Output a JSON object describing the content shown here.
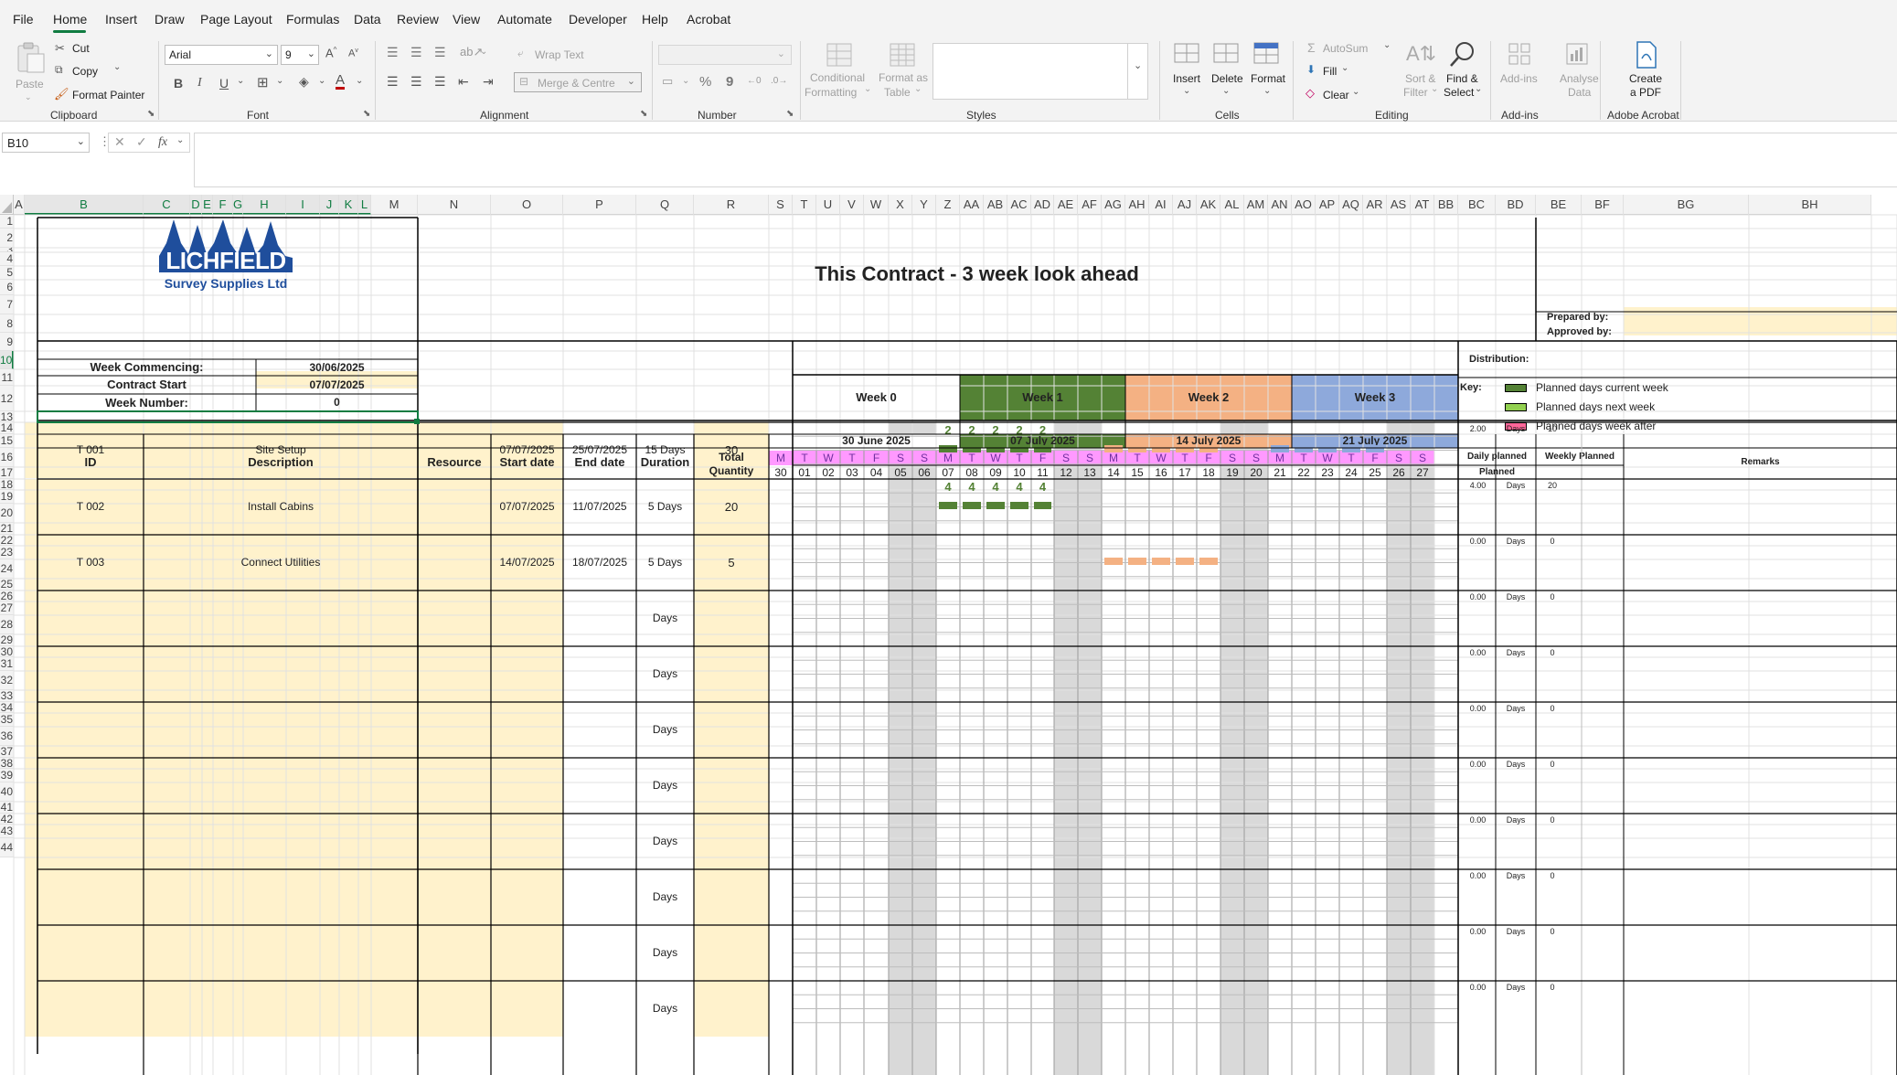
{
  "tabs": [
    "File",
    "Home",
    "Insert",
    "Draw",
    "Page Layout",
    "Formulas",
    "Data",
    "Review",
    "View",
    "Automate",
    "Developer",
    "Help",
    "Acrobat"
  ],
  "ribbon": {
    "clipboard": {
      "paste": "Paste",
      "cut": "Cut",
      "copy": "Copy",
      "format_painter": "Format Painter",
      "label": "Clipboard"
    },
    "font": {
      "family": "Arial",
      "size": "9",
      "bold": "B",
      "italic": "I",
      "underline": "U",
      "label": "Font"
    },
    "alignment": {
      "wrap": "Wrap Text",
      "merge": "Merge & Centre",
      "label": "Alignment"
    },
    "number": {
      "percent": "%",
      "comma": "9",
      "label": "Number"
    },
    "styles": {
      "conditional": "Conditional",
      "conditional2": "Formatting",
      "format_table": "Format as",
      "format_table2": "Table",
      "label": "Styles"
    },
    "cells": {
      "insert": "Insert",
      "delete": "Delete",
      "format": "Format",
      "label": "Cells"
    },
    "editing": {
      "autosum": "AutoSum",
      "fill": "Fill",
      "clear": "Clear",
      "sort": "Sort &",
      "sort2": "Filter",
      "find": "Find &",
      "find2": "Select",
      "label": "Editing"
    },
    "addins": {
      "addins": "Add-ins",
      "analyse": "Analyse",
      "analyse2": "Data",
      "label": "Add-ins"
    },
    "acrobat": {
      "create": "Create",
      "create2": "a PDF",
      "label": "Adobe Acrobat"
    }
  },
  "formula_bar": {
    "name_box": "B10",
    "fx": "fx",
    "value": ""
  },
  "columns": [
    "A",
    "B",
    "C",
    "D",
    "E",
    "F",
    "G",
    "H",
    "I",
    "J",
    "K",
    "L",
    "M",
    "N",
    "O",
    "P",
    "Q",
    "R",
    "S",
    "T",
    "U",
    "V",
    "W",
    "X",
    "Y",
    "Z",
    "AA",
    "AB",
    "AC",
    "AD",
    "AE",
    "AF",
    "AG",
    "AH",
    "AI",
    "AJ",
    "AK",
    "AL",
    "AM",
    "AN",
    "AO",
    "AP",
    "AQ",
    "AR",
    "AS",
    "AT",
    "BB",
    "BC",
    "BD",
    "BE",
    "BF",
    "BG",
    "BH"
  ],
  "rows": [
    "1",
    "2",
    "3",
    "4",
    "5",
    "6",
    "7",
    "8",
    "9",
    "10",
    "11",
    "12",
    "13",
    "14",
    "15",
    "16",
    "17",
    "18",
    "19",
    "20",
    "21",
    "22",
    "23",
    "24",
    "25",
    "26",
    "27",
    "28",
    "29",
    "30",
    "31",
    "32",
    "33",
    "34",
    "35",
    "36",
    "37",
    "38",
    "39",
    "40",
    "41",
    "42",
    "43",
    "44"
  ],
  "logo": {
    "line1": "LICHFIELD",
    "line2": "Survey Supplies Ltd"
  },
  "sheet": {
    "title": "This Contract - 3 week look ahead",
    "prepared_by": "Prepared by:",
    "approved_by": "Approved by:",
    "distribution": "Distribution:",
    "week_commencing_label": "Week Commencing:",
    "week_commencing": "30/06/2025",
    "contract_start_label": "Contract Start",
    "contract_start": "07/07/2025",
    "week_number_label": "Week Number:",
    "week_number": "0",
    "headers": {
      "id": "ID",
      "description": "Description",
      "resource": "Resource",
      "start": "Start date",
      "end": "End date",
      "duration": "Duration",
      "total1": "Total",
      "total2": "Quantity",
      "daily1": "Daily planned",
      "daily2": "Planned",
      "weekly": "Weekly Planned",
      "remarks": "Remarks"
    },
    "weeks": [
      {
        "label": "Week 0",
        "date": "30 June 2025",
        "color": "#ffffff"
      },
      {
        "label": "Week 1",
        "date": "07 July 2025",
        "color": "#548235"
      },
      {
        "label": "Week 2",
        "date": "14 July 2025",
        "color": "#f4b183"
      },
      {
        "label": "Week 3",
        "date": "21 July 2025",
        "color": "#8ea9db"
      }
    ],
    "day_letters": [
      "M",
      "T",
      "W",
      "T",
      "F",
      "S",
      "S"
    ],
    "day_numbers": [
      "30",
      "01",
      "02",
      "03",
      "04",
      "05",
      "06",
      "07",
      "08",
      "09",
      "10",
      "11",
      "12",
      "13",
      "14",
      "15",
      "16",
      "17",
      "18",
      "19",
      "20",
      "21",
      "22",
      "23",
      "24",
      "25",
      "26",
      "27"
    ],
    "key": {
      "title": "Key:",
      "items": [
        {
          "text": "Planned days current week",
          "color": "#548235"
        },
        {
          "text": "Planned days next week",
          "color": "#92d050"
        },
        {
          "text": "Planned days week after",
          "color": "#ff6699"
        }
      ]
    },
    "tasks": [
      {
        "id": "T 001",
        "desc": "Site Setup",
        "start": "07/07/2025",
        "end": "25/07/2025",
        "duration": "15 Days",
        "qty": "30",
        "daily": "2.00",
        "unit": "Days",
        "weekly": "10",
        "qty_marks": [
          "2",
          "2",
          "2",
          "2",
          "2"
        ]
      },
      {
        "id": "T 002",
        "desc": "Install Cabins",
        "start": "07/07/2025",
        "end": "11/07/2025",
        "duration": "5 Days",
        "qty": "20",
        "daily": "4.00",
        "unit": "Days",
        "weekly": "20",
        "qty_marks": [
          "4",
          "4",
          "4",
          "4",
          "4"
        ]
      },
      {
        "id": "T 003",
        "desc": "Connect Utilities",
        "start": "14/07/2025",
        "end": "18/07/2025",
        "duration": "5 Days",
        "qty": "5",
        "daily": "0.00",
        "unit": "Days",
        "weekly": "0",
        "qty_marks": []
      },
      {
        "id": "",
        "desc": "",
        "start": "",
        "end": "",
        "duration": "Days",
        "qty": "",
        "daily": "0.00",
        "unit": "Days",
        "weekly": "0",
        "qty_marks": []
      },
      {
        "id": "",
        "desc": "",
        "start": "",
        "end": "",
        "duration": "Days",
        "qty": "",
        "daily": "0.00",
        "unit": "Days",
        "weekly": "0",
        "qty_marks": []
      },
      {
        "id": "",
        "desc": "",
        "start": "",
        "end": "",
        "duration": "Days",
        "qty": "",
        "daily": "0.00",
        "unit": "Days",
        "weekly": "0",
        "qty_marks": []
      },
      {
        "id": "",
        "desc": "",
        "start": "",
        "end": "",
        "duration": "Days",
        "qty": "",
        "daily": "0.00",
        "unit": "Days",
        "weekly": "0",
        "qty_marks": []
      },
      {
        "id": "",
        "desc": "",
        "start": "",
        "end": "",
        "duration": "Days",
        "qty": "",
        "daily": "0.00",
        "unit": "Days",
        "weekly": "0",
        "qty_marks": []
      },
      {
        "id": "",
        "desc": "",
        "start": "",
        "end": "",
        "duration": "Days",
        "qty": "",
        "daily": "0.00",
        "unit": "Days",
        "weekly": "0",
        "qty_marks": []
      },
      {
        "id": "",
        "desc": "",
        "start": "",
        "end": "",
        "duration": "Days",
        "qty": "",
        "daily": "0.00",
        "unit": "Days",
        "weekly": "0",
        "qty_marks": []
      },
      {
        "id": "",
        "desc": "",
        "start": "",
        "end": "",
        "duration": "Days",
        "qty": "",
        "daily": "0.00",
        "unit": "Days",
        "weekly": "0",
        "qty_marks": []
      }
    ]
  },
  "colors": {
    "ribbon_bg": "#f3f3f3",
    "accent": "#107c41",
    "cell_yellow": "#fff2cc",
    "weekday_pink": "#ff99ff",
    "weekend_gray": "#d9d9d9"
  }
}
